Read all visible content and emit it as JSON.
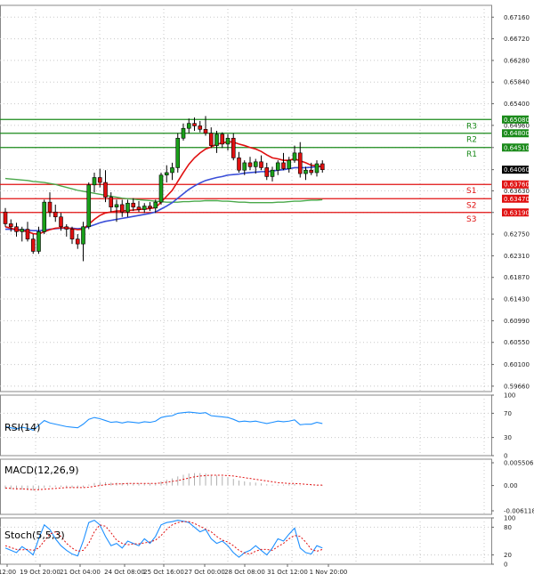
{
  "chart_data": {
    "type": "candlestick",
    "price_axis": {
      "ticks": [
        0.6716,
        0.6672,
        0.6628,
        0.6584,
        0.654,
        0.6496,
        0.6451,
        0.6406,
        0.6363,
        0.6319,
        0.6275,
        0.6231,
        0.6187,
        0.6143,
        0.6099,
        0.6055,
        0.601,
        0.5966
      ],
      "ylim": [
        0.5955,
        0.674
      ]
    },
    "x_axis": {
      "tick_labels": [
        "12:00",
        "19 Oct 20:00",
        "21 Oct 04:00",
        "24 Oct 08:00",
        "25 Oct 16:00",
        "27 Oct 00:00",
        "28 Oct 08:00",
        "31 Oct 12:00",
        "1 Nov 20:00"
      ]
    },
    "current_price": {
      "value": 0.6406,
      "label": "0.64060"
    },
    "levels": [
      {
        "name": "R3",
        "value": 0.6508,
        "label": "0.65080",
        "color": "#1a8a1a"
      },
      {
        "name": "R2",
        "value": 0.648,
        "label": "0.64800",
        "color": "#1a8a1a"
      },
      {
        "name": "R1",
        "value": 0.6451,
        "label": "0.64510",
        "color": "#1a8a1a"
      },
      {
        "name": "S1",
        "value": 0.6376,
        "label": "0.63760",
        "color": "#e01010"
      },
      {
        "name": "S2",
        "value": 0.6347,
        "label": "0.63470",
        "color": "#e01010"
      },
      {
        "name": "S3",
        "value": 0.6319,
        "label": "0.63190",
        "color": "#e01010"
      }
    ],
    "candles": [
      [
        0.632,
        0.6328,
        0.629,
        0.6296
      ],
      [
        0.6296,
        0.6305,
        0.628,
        0.629
      ],
      [
        0.629,
        0.6298,
        0.627,
        0.628
      ],
      [
        0.628,
        0.629,
        0.626,
        0.6285
      ],
      [
        0.6285,
        0.63,
        0.626,
        0.6265
      ],
      [
        0.6265,
        0.6275,
        0.6235,
        0.624
      ],
      [
        0.624,
        0.629,
        0.6235,
        0.628
      ],
      [
        0.628,
        0.6345,
        0.6275,
        0.634
      ],
      [
        0.634,
        0.636,
        0.631,
        0.632
      ],
      [
        0.632,
        0.6335,
        0.63,
        0.631
      ],
      [
        0.631,
        0.6318,
        0.6282,
        0.629
      ],
      [
        0.629,
        0.6295,
        0.627,
        0.6285
      ],
      [
        0.6285,
        0.629,
        0.6255,
        0.6265
      ],
      [
        0.6265,
        0.6275,
        0.6245,
        0.6255
      ],
      [
        0.6255,
        0.63,
        0.622,
        0.629
      ],
      [
        0.629,
        0.638,
        0.6285,
        0.6375
      ],
      [
        0.6375,
        0.64,
        0.636,
        0.639
      ],
      [
        0.639,
        0.6408,
        0.637,
        0.638
      ],
      [
        0.638,
        0.6405,
        0.634,
        0.635
      ],
      [
        0.635,
        0.636,
        0.632,
        0.633
      ],
      [
        0.633,
        0.6345,
        0.63,
        0.6335
      ],
      [
        0.6335,
        0.6345,
        0.631,
        0.632
      ],
      [
        0.632,
        0.6345,
        0.631,
        0.6338
      ],
      [
        0.6338,
        0.6348,
        0.6322,
        0.633
      ],
      [
        0.633,
        0.6342,
        0.632,
        0.6325
      ],
      [
        0.6325,
        0.6338,
        0.6318,
        0.6332
      ],
      [
        0.6332,
        0.634,
        0.6322,
        0.6328
      ],
      [
        0.6328,
        0.6345,
        0.6318,
        0.634
      ],
      [
        0.634,
        0.64,
        0.6335,
        0.6395
      ],
      [
        0.6395,
        0.6415,
        0.638,
        0.64
      ],
      [
        0.64,
        0.642,
        0.6385,
        0.641
      ],
      [
        0.641,
        0.648,
        0.64,
        0.647
      ],
      [
        0.647,
        0.65,
        0.6465,
        0.649
      ],
      [
        0.649,
        0.651,
        0.648,
        0.65
      ],
      [
        0.65,
        0.6512,
        0.6485,
        0.6495
      ],
      [
        0.6495,
        0.6505,
        0.6482,
        0.6488
      ],
      [
        0.6488,
        0.6515,
        0.6475,
        0.648
      ],
      [
        0.648,
        0.6492,
        0.645,
        0.6455
      ],
      [
        0.6455,
        0.6485,
        0.644,
        0.6478
      ],
      [
        0.6478,
        0.6482,
        0.645,
        0.6458
      ],
      [
        0.6458,
        0.6478,
        0.6445,
        0.647
      ],
      [
        0.647,
        0.648,
        0.6425,
        0.643
      ],
      [
        0.643,
        0.6442,
        0.64,
        0.6405
      ],
      [
        0.6405,
        0.6425,
        0.6395,
        0.642
      ],
      [
        0.642,
        0.6432,
        0.6405,
        0.6412
      ],
      [
        0.6412,
        0.6428,
        0.6398,
        0.6422
      ],
      [
        0.6422,
        0.6435,
        0.6405,
        0.641
      ],
      [
        0.641,
        0.642,
        0.6385,
        0.6392
      ],
      [
        0.6392,
        0.6412,
        0.6382,
        0.6405
      ],
      [
        0.6405,
        0.6425,
        0.6395,
        0.642
      ],
      [
        0.642,
        0.644,
        0.6405,
        0.6408
      ],
      [
        0.6408,
        0.6432,
        0.64,
        0.6425
      ],
      [
        0.6425,
        0.6455,
        0.642,
        0.644
      ],
      [
        0.644,
        0.6462,
        0.639,
        0.6398
      ],
      [
        0.6398,
        0.6412,
        0.6385,
        0.6405
      ],
      [
        0.6405,
        0.642,
        0.6395,
        0.64
      ],
      [
        0.64,
        0.6425,
        0.6392,
        0.6418
      ],
      [
        0.6418,
        0.6425,
        0.64,
        0.6406
      ]
    ],
    "ma_red": [
      0.629,
      0.6287,
      0.6284,
      0.6282,
      0.628,
      0.6276,
      0.6275,
      0.628,
      0.6284,
      0.6287,
      0.6288,
      0.6288,
      0.6286,
      0.6284,
      0.6285,
      0.6295,
      0.6305,
      0.6313,
      0.6318,
      0.632,
      0.6322,
      0.6322,
      0.6323,
      0.6324,
      0.6325,
      0.6326,
      0.6327,
      0.6329,
      0.634,
      0.6352,
      0.6364,
      0.6382,
      0.64,
      0.6417,
      0.643,
      0.644,
      0.6448,
      0.6452,
      0.6458,
      0.646,
      0.6463,
      0.6462,
      0.6458,
      0.6455,
      0.6451,
      0.6448,
      0.6443,
      0.6436,
      0.643,
      0.6428,
      0.6425,
      0.6425,
      0.6428,
      0.6424,
      0.642,
      0.6415,
      0.6414,
      0.6412
    ],
    "ma_blue": [
      0.6285,
      0.6285,
      0.6284,
      0.6284,
      0.6283,
      0.6282,
      0.6282,
      0.6283,
      0.6285,
      0.6286,
      0.6287,
      0.6287,
      0.6287,
      0.6286,
      0.6287,
      0.629,
      0.6294,
      0.6298,
      0.6301,
      0.6303,
      0.6305,
      0.6307,
      0.6309,
      0.6311,
      0.6313,
      0.6315,
      0.6317,
      0.632,
      0.6326,
      0.6332,
      0.6339,
      0.6348,
      0.6357,
      0.6366,
      0.6373,
      0.6379,
      0.6384,
      0.6387,
      0.639,
      0.6392,
      0.6395,
      0.6396,
      0.6397,
      0.6399,
      0.64,
      0.6401,
      0.6402,
      0.6402,
      0.6403,
      0.6405,
      0.6406,
      0.6408,
      0.641,
      0.641,
      0.641,
      0.6411,
      0.6412,
      0.6412
    ],
    "ma_green": [
      0.6388,
      0.6387,
      0.6386,
      0.6385,
      0.6384,
      0.6382,
      0.6381,
      0.638,
      0.6378,
      0.6376,
      0.6373,
      0.637,
      0.6367,
      0.6364,
      0.6362,
      0.636,
      0.6358,
      0.6356,
      0.6354,
      0.6352,
      0.635,
      0.6348,
      0.6347,
      0.6346,
      0.6345,
      0.6344,
      0.6343,
      0.6342,
      0.6341,
      0.634,
      0.634,
      0.634,
      0.6341,
      0.6341,
      0.6342,
      0.6342,
      0.6343,
      0.6343,
      0.6343,
      0.6342,
      0.6342,
      0.6341,
      0.634,
      0.634,
      0.6339,
      0.6339,
      0.6339,
      0.6339,
      0.6339,
      0.634,
      0.634,
      0.6341,
      0.6342,
      0.6342,
      0.6343,
      0.6344,
      0.6344,
      0.6345
    ],
    "rsi": {
      "label": "RSI(14)",
      "ticks": [
        100,
        70,
        30,
        0
      ],
      "values": [
        48,
        46,
        44,
        47,
        45,
        42,
        50,
        58,
        54,
        52,
        50,
        48,
        47,
        46,
        52,
        60,
        63,
        61,
        58,
        55,
        56,
        54,
        56,
        55,
        54,
        56,
        55,
        57,
        63,
        65,
        66,
        70,
        71,
        72,
        71,
        70,
        71,
        66,
        65,
        64,
        63,
        60,
        56,
        57,
        56,
        57,
        55,
        53,
        55,
        57,
        56,
        57,
        59,
        51,
        52,
        52,
        55,
        53
      ]
    },
    "macd": {
      "label": "MACD(12,26,9)",
      "ticks": [
        "0.005506",
        "0.00",
        "-0.006118"
      ],
      "tick_values": [
        0.005506,
        0.0,
        -0.006118
      ],
      "histogram": [
        -0.0008,
        -0.0009,
        -0.001,
        -0.001,
        -0.0011,
        -0.0012,
        -0.001,
        -0.0006,
        -0.0004,
        -0.0003,
        -0.0003,
        -0.0004,
        -0.0005,
        -0.0006,
        -0.0004,
        0.0002,
        0.0006,
        0.0008,
        0.0008,
        0.0007,
        0.0007,
        0.0006,
        0.0006,
        0.0006,
        0.0005,
        0.0005,
        0.0005,
        0.0006,
        0.001,
        0.0014,
        0.0017,
        0.0022,
        0.0026,
        0.0029,
        0.003,
        0.003,
        0.0029,
        0.0026,
        0.0024,
        0.0022,
        0.002,
        0.0016,
        0.0012,
        0.001,
        0.0008,
        0.0007,
        0.0005,
        0.0003,
        0.0002,
        0.0002,
        0.0002,
        0.0003,
        0.0004,
        0.0001,
        0.0,
        -0.0001,
        -0.0001,
        -0.0001
      ],
      "signal": [
        -0.0006,
        -0.0007,
        -0.0008,
        -0.0008,
        -0.0009,
        -0.001,
        -0.001,
        -0.0009,
        -0.0008,
        -0.0007,
        -0.0006,
        -0.0005,
        -0.0005,
        -0.0005,
        -0.0005,
        -0.0004,
        -0.0002,
        0.0,
        0.0002,
        0.0003,
        0.0004,
        0.0004,
        0.0005,
        0.0005,
        0.0005,
        0.0005,
        0.0005,
        0.0005,
        0.0006,
        0.0008,
        0.001,
        0.0012,
        0.0015,
        0.0018,
        0.0021,
        0.0023,
        0.0024,
        0.0025,
        0.0025,
        0.0025,
        0.0024,
        0.0023,
        0.0021,
        0.0019,
        0.0017,
        0.0015,
        0.0013,
        0.0011,
        0.0009,
        0.0007,
        0.0006,
        0.0005,
        0.0005,
        0.0004,
        0.0003,
        0.0002,
        0.0001,
        0.0001
      ]
    },
    "stoch": {
      "label": "Stoch(5,5,3)",
      "ticks": [
        100,
        80,
        20,
        0
      ],
      "k": [
        35,
        30,
        25,
        38,
        30,
        20,
        55,
        85,
        75,
        55,
        40,
        30,
        22,
        18,
        50,
        90,
        95,
        85,
        60,
        40,
        45,
        35,
        50,
        45,
        40,
        55,
        45,
        60,
        85,
        90,
        92,
        95,
        93,
        90,
        80,
        70,
        75,
        55,
        45,
        50,
        40,
        25,
        15,
        25,
        30,
        40,
        30,
        20,
        35,
        55,
        50,
        65,
        78,
        35,
        25,
        22,
        40,
        35
      ],
      "d": [
        40,
        36,
        32,
        31,
        32,
        30,
        35,
        50,
        65,
        70,
        60,
        45,
        35,
        28,
        30,
        45,
        70,
        85,
        82,
        68,
        52,
        45,
        42,
        44,
        44,
        46,
        48,
        52,
        62,
        75,
        85,
        90,
        92,
        92,
        88,
        82,
        76,
        70,
        60,
        52,
        48,
        40,
        30,
        24,
        22,
        28,
        32,
        32,
        30,
        38,
        45,
        55,
        62,
        60,
        48,
        32,
        28,
        32
      ]
    }
  }
}
